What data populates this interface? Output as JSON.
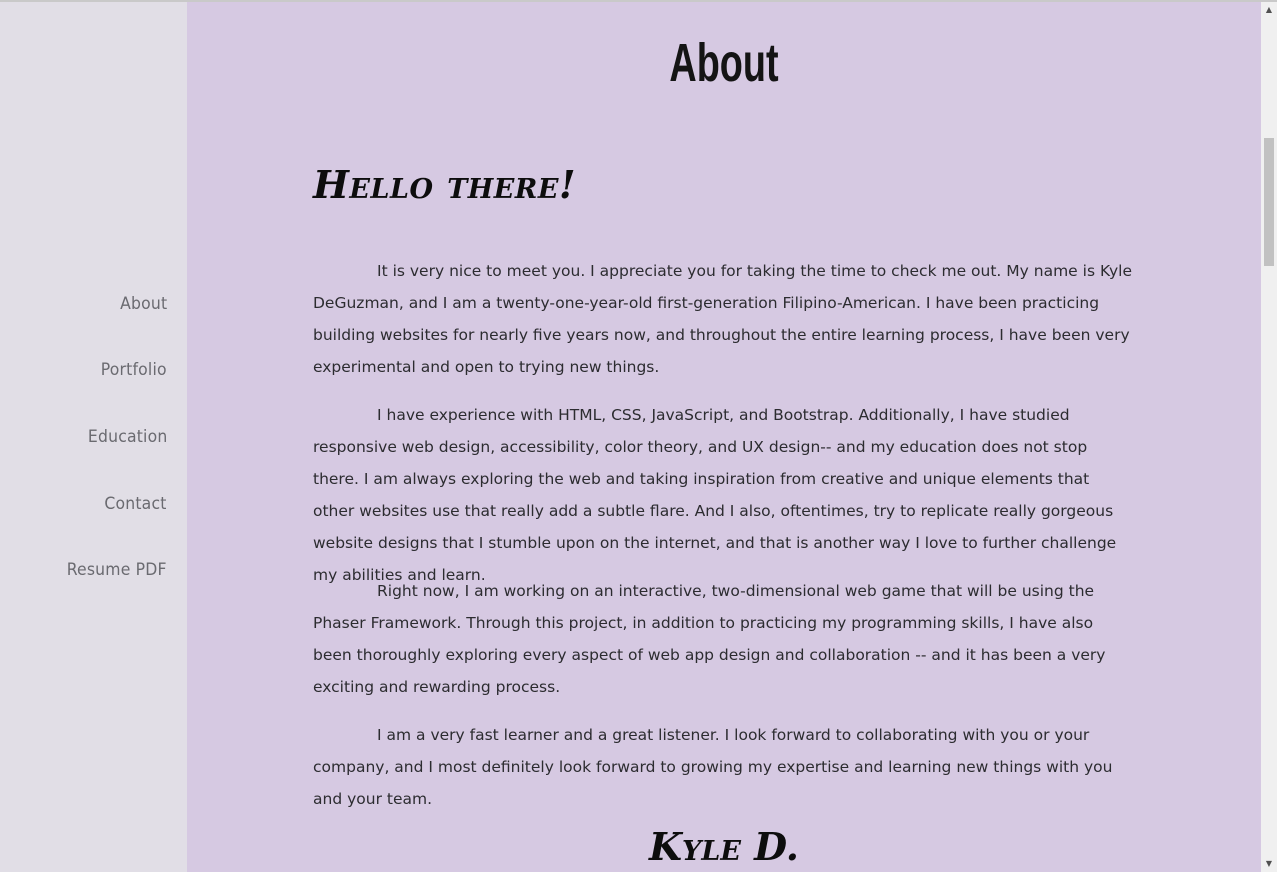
{
  "sidebar": {
    "items": [
      {
        "label": "About"
      },
      {
        "label": "Portfolio"
      },
      {
        "label": "Education"
      },
      {
        "label": "Contact"
      },
      {
        "label": "Resume PDF"
      }
    ]
  },
  "main": {
    "title": "About",
    "greeting": "Hello there!",
    "paragraphs": [
      "It is very nice to meet you. I appreciate you for taking the time to check me out. My name is Kyle DeGuzman, and I am a twenty-one-year-old first-generation Filipino-American. I have been practicing building websites for nearly five years now, and throughout the entire learning process, I have been very experimental and open to trying new things.",
      "I have experience with HTML, CSS, JavaScript, and Bootstrap. Additionally, I have studied responsive web design, accessibility, color theory, and UX design-- and my education does not stop there. I am always exploring the web and taking inspiration from creative and unique elements that other websites use that really add a subtle flare. And I also, oftentimes, try to replicate really gorgeous website designs that I stumble upon on the internet, and that is another way I love to further challenge my abilities and learn.",
      "Right now, I am working on an interactive, two-dimensional web game that will be using the Phaser Framework. Through this project, in addition to practicing my programming skills, I have also been thoroughly exploring every aspect of web app design and collaboration -- and it has been a very exciting and rewarding process.",
      "I am a very fast learner and a great listener. I look forward to collaborating with you or your company, and I most definitely look forward to growing my expertise and learning new things with you and your team."
    ],
    "signature": "Kyle D."
  },
  "colors": {
    "sidebar_bg": "#e1dee6",
    "main_bg": "#d6c9e2",
    "nav_text": "#6a6a70",
    "body_text": "#2c2c30"
  }
}
